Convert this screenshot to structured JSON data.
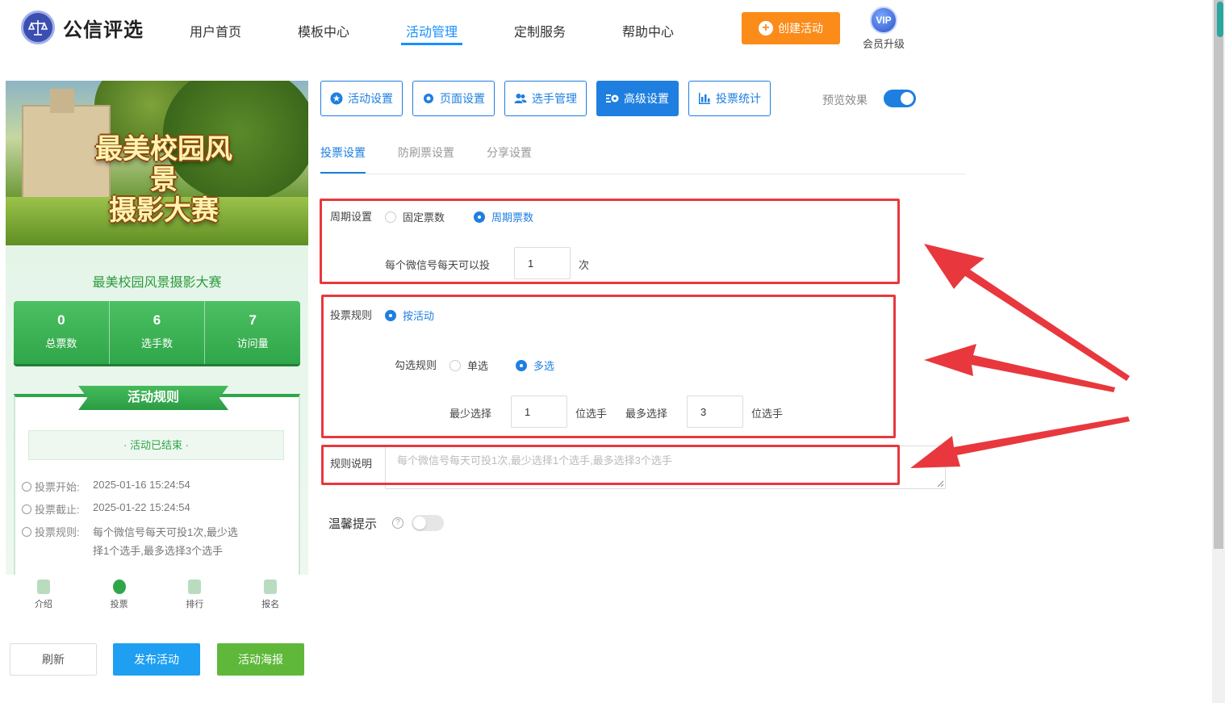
{
  "header": {
    "brand": "公信评选",
    "nav": [
      "用户首页",
      "模板中心",
      "活动管理",
      "定制服务",
      "帮助中心"
    ],
    "active_nav": "活动管理",
    "create_label": "创建活动",
    "vip_badge": "VIP",
    "vip_label": "会员升级"
  },
  "preview": {
    "banner_title_line1": "最美校园风景",
    "banner_title_line2": "摄影大赛",
    "activity_name": "最美校园风景摄影大赛",
    "stats": [
      {
        "value": "0",
        "label": "总票数"
      },
      {
        "value": "6",
        "label": "选手数"
      },
      {
        "value": "7",
        "label": "访问量"
      }
    ],
    "rules_title": "活动规则",
    "status": "活动已结束",
    "vote_start_label": "投票开始:",
    "vote_start": "2025-01-16 15:24:54",
    "vote_end_label": "投票截止:",
    "vote_end": "2025-01-22 15:24:54",
    "vote_rule_label": "投票规则:",
    "vote_rule_line1": "每个微信号每天可投1次,最少选",
    "vote_rule_line2": "择1个选手,最多选择3个选手",
    "tabbar": [
      "介绍",
      "投票",
      "排行",
      "报名"
    ]
  },
  "footer_buttons": {
    "refresh": "刷新",
    "publish": "发布活动",
    "poster": "活动海报"
  },
  "settings_tabs": [
    "活动设置",
    "页面设置",
    "选手管理",
    "高级设置",
    "投票统计"
  ],
  "active_settings_tab": "高级设置",
  "preview_toggle": {
    "label": "预览效果",
    "on": true
  },
  "sub_tabs": [
    "投票设置",
    "防刷票设置",
    "分享设置"
  ],
  "active_sub_tab": "投票设置",
  "cycle": {
    "label": "周期设置",
    "options": [
      "固定票数",
      "周期票数"
    ],
    "selected": "周期票数",
    "per_day_label": "每个微信号每天可以投",
    "per_day_value": "1",
    "per_day_unit": "次"
  },
  "vote_rule": {
    "label": "投票规则",
    "option": "按活动",
    "check_label": "勾选规则",
    "check_options": [
      "单选",
      "多选"
    ],
    "check_selected": "多选",
    "min_label": "最少选择",
    "min_value": "1",
    "min_unit": "位选手",
    "max_label": "最多选择",
    "max_value": "3",
    "max_unit": "位选手"
  },
  "rule_desc": {
    "label": "规则说明",
    "placeholder": "每个微信号每天可投1次,最少选择1个选手,最多选择3个选手"
  },
  "tip": {
    "label": "温馨提示",
    "help": "?",
    "on": false
  },
  "colors": {
    "accent": "#1e7fe0",
    "highlight": "#e8383d",
    "green": "#2fa649",
    "orange": "#fb8c1a"
  }
}
